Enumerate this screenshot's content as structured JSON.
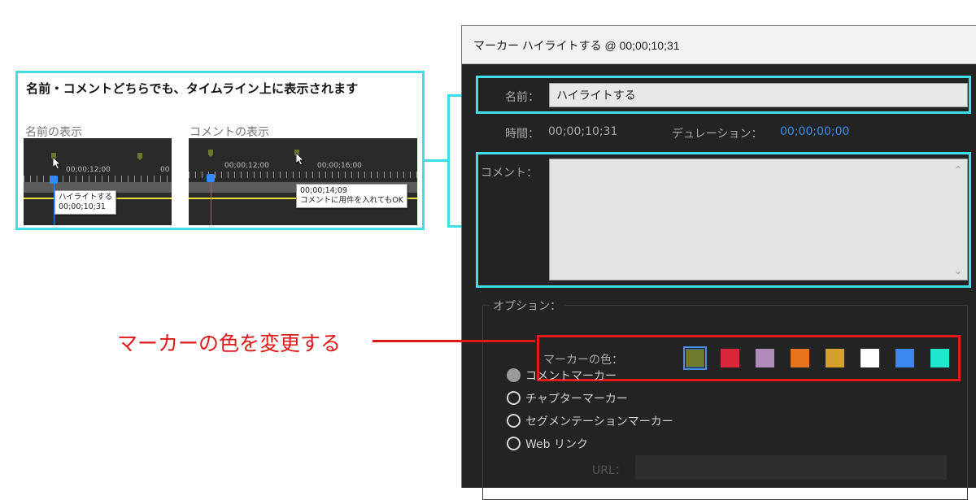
{
  "callout": {
    "title": "名前・コメントどちらでも、タイムライン上に表示されます",
    "name_display_label": "名前の表示",
    "comment_display_label": "コメントの表示",
    "left_timeline": {
      "timecode_1": "00;00;12;00",
      "timecode_2": "00",
      "tooltip_line1": "ハイライトする",
      "tooltip_line2": "00;00;10;31"
    },
    "right_timeline": {
      "timecode_1": "00;00;12;00",
      "timecode_2": "00;00;16;00",
      "tooltip_line1": "00;00;14;09",
      "tooltip_line2": "コメントに用件を入れてもOK"
    }
  },
  "dialog": {
    "title": "マーカー ハイライトする @ 00;00;10;31",
    "name_label": "名前：",
    "name_value": "ハイライトする",
    "time_label": "時間：",
    "time_value": "00;00;10;31",
    "duration_label": "デュレーション：",
    "duration_value": "00;00;00;00",
    "comment_label": "コメント：",
    "comment_value": "",
    "options_label": "オプション：",
    "marker_color_label": "マーカーの色：",
    "marker_colors": [
      "#6e7d2c",
      "#d8283a",
      "#b08ab8",
      "#e8721e",
      "#d4a12a",
      "#ffffff",
      "#3a88f0",
      "#1fe6cc"
    ],
    "selected_color_index": 0,
    "marker_types": [
      {
        "label": "コメントマーカー",
        "selected": true
      },
      {
        "label": "チャプターマーカー",
        "selected": false
      },
      {
        "label": "セグメンテーションマーカー",
        "selected": false
      },
      {
        "label": "Web リンク",
        "selected": false
      }
    ],
    "url_label": "URL："
  },
  "annotation": {
    "text": "マーカーの色を変更する",
    "color": "#e01818"
  },
  "accent_colors": {
    "highlight_cyan": "#3fdfe8",
    "highlight_red": "#e51b1b",
    "duration_blue": "#3d8ee8"
  }
}
